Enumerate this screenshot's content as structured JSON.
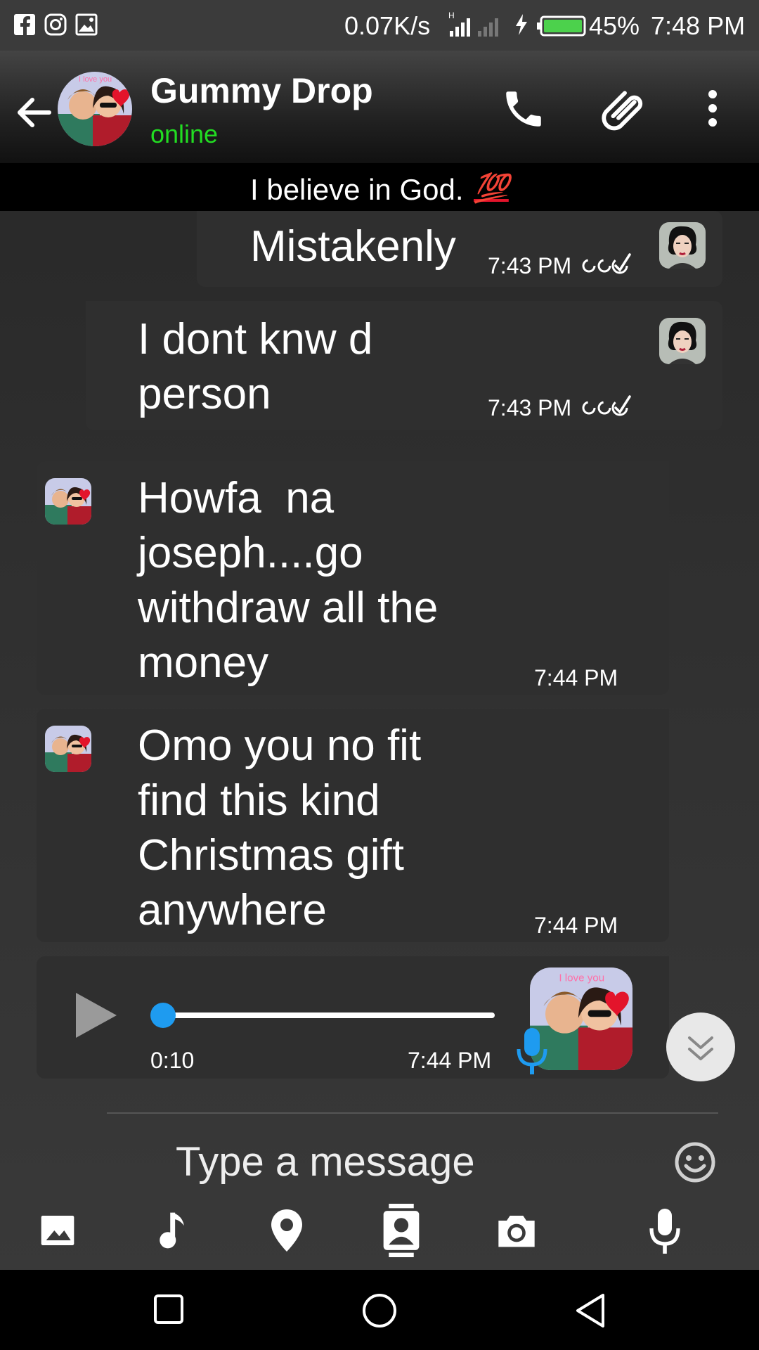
{
  "status_bar": {
    "net_speed": "0.07K/s",
    "battery": "45%",
    "time": "7:48 PM",
    "signal_mark": "H"
  },
  "header": {
    "contact_name": "Gummy Drop",
    "status": "online",
    "status_color": "#22dd22",
    "about": "I believe in God.",
    "about_emoji": "💯"
  },
  "avatar_text": "I love you",
  "messages": [
    {
      "text": "Mistakenly",
      "time": "7:43 PM",
      "direction": "outgoing"
    },
    {
      "text": "I dont knw d\nperson",
      "time": "7:43 PM",
      "direction": "outgoing"
    },
    {
      "text": "Howfa  na\njoseph....go\nwithdraw all the\nmoney",
      "time": "7:44 PM",
      "direction": "incoming"
    },
    {
      "text": "Omo you no fit\nfind this kind\nChristmas gift\nanywhere",
      "time": "7:44 PM",
      "direction": "incoming"
    }
  ],
  "voice_note": {
    "duration": "0:10",
    "time": "7:44 PM",
    "progress": 0.0,
    "accent_color": "#1e9bf0"
  },
  "composer": {
    "placeholder": "Type a message"
  },
  "attach_bar": [
    "gallery-icon",
    "music-icon",
    "location-icon",
    "contact-icon",
    "camera-icon",
    "mic-icon"
  ]
}
